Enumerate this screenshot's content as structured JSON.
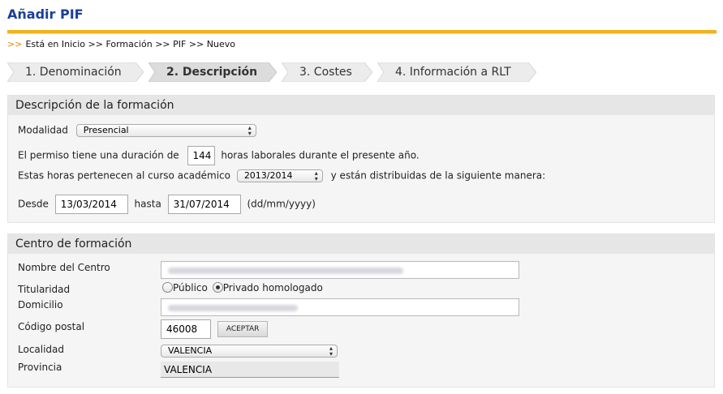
{
  "page": {
    "title": "Añadir PIF"
  },
  "breadcrumb": {
    "arrows": ">>",
    "text": "Está en Inicio >> Formación >> PIF >> Nuevo"
  },
  "steps": [
    {
      "label": "1. Denominación",
      "active": false
    },
    {
      "label": "2. Descripción",
      "active": true
    },
    {
      "label": "3. Costes",
      "active": false
    },
    {
      "label": "4. Información a RLT",
      "active": false
    }
  ],
  "descripcion": {
    "heading": "Descripción de la formación",
    "modalidad_label": "Modalidad",
    "modalidad_value": "Presencial",
    "duracion_prefix": "El permiso tiene una duración de",
    "duracion_value": "144",
    "duracion_suffix": "horas laborales durante el presente año.",
    "curso_prefix": "Estas horas pertenecen al curso académico",
    "curso_value": "2013/2014",
    "curso_suffix": "y están distribuidas de la siguiente manera:",
    "desde_label": "Desde",
    "desde_value": "13/03/2014",
    "hasta_label": "hasta",
    "hasta_value": "31/07/2014",
    "date_format": "(dd/mm/yyyy)"
  },
  "centro": {
    "heading": "Centro de formación",
    "nombre_label": "Nombre del Centro",
    "titularidad_label": "Titularidad",
    "titularidad_options": [
      "Público",
      "Privado homologado"
    ],
    "titularidad_selected": "Privado homologado",
    "domicilio_label": "Domicilio",
    "cp_label": "Código postal",
    "cp_value": "46008",
    "aceptar_label": "ACEPTAR",
    "localidad_label": "Localidad",
    "localidad_value": "VALENCIA",
    "provincia_label": "Provincia",
    "provincia_value": "VALENCIA"
  },
  "colors": {
    "title": "#1a3f9a",
    "rule": "#f2b21c",
    "arrows": "#f0a020"
  }
}
